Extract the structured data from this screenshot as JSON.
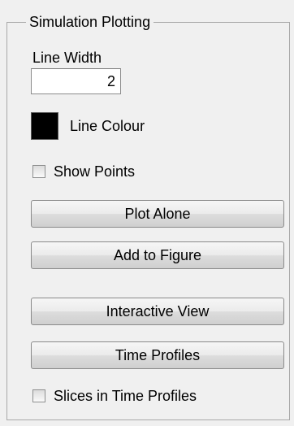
{
  "panel": {
    "title": "Simulation Plotting",
    "line_width_label": "Line Width",
    "line_width_value": "2",
    "line_colour_label": "Line Colour",
    "line_colour_value": "#000000",
    "show_points_label": "Show Points",
    "show_points_checked": false,
    "buttons": {
      "plot_alone": "Plot Alone",
      "add_to_figure": "Add to Figure",
      "interactive_view": "Interactive View",
      "time_profiles": "Time Profiles"
    },
    "slices_label": "Slices in Time Profiles",
    "slices_checked": false
  }
}
